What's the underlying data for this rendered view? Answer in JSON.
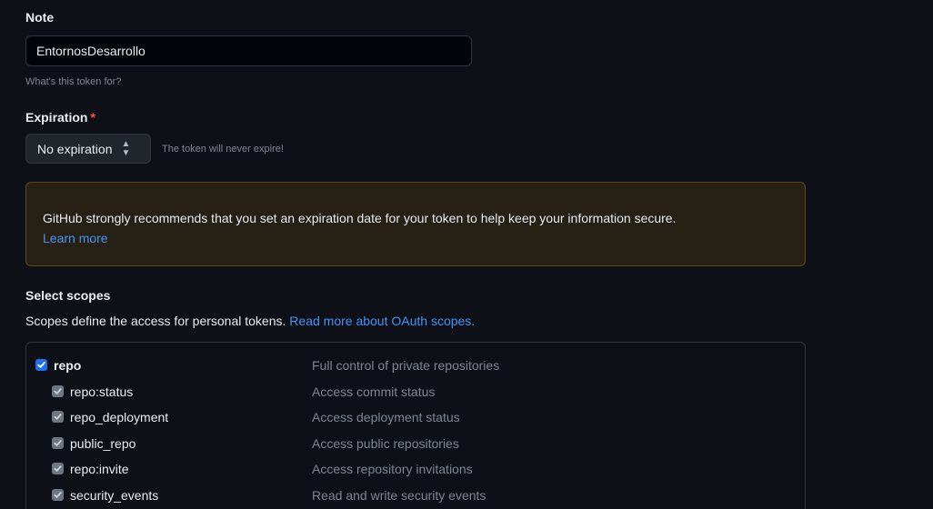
{
  "note": {
    "label": "Note",
    "value": "EntornosDesarrollo",
    "hint": "What's this token for?"
  },
  "expiration": {
    "label": "Expiration",
    "required_mark": "*",
    "selected": "No expiration",
    "hint": "The token will never expire!"
  },
  "warning": {
    "text": "GitHub strongly recommends that you set an expiration date for your token to help keep your information secure.",
    "link": "Learn more"
  },
  "scopes": {
    "title": "Select scopes",
    "description": "Scopes define the access for personal tokens.",
    "link": "Read more about OAuth scopes.",
    "items": [
      {
        "name": "repo",
        "description": "Full control of private repositories",
        "checked": true,
        "parent": true
      },
      {
        "name": "repo:status",
        "description": "Access commit status",
        "checked": true,
        "parent": false
      },
      {
        "name": "repo_deployment",
        "description": "Access deployment status",
        "checked": true,
        "parent": false
      },
      {
        "name": "public_repo",
        "description": "Access public repositories",
        "checked": true,
        "parent": false
      },
      {
        "name": "repo:invite",
        "description": "Access repository invitations",
        "checked": true,
        "parent": false
      },
      {
        "name": "security_events",
        "description": "Read and write security events",
        "checked": true,
        "parent": false
      }
    ]
  },
  "colors": {
    "background": "#0d1117",
    "accent_link": "#4493f8",
    "checkbox_primary": "#1f6feb",
    "checkbox_inherited": "#6e7681",
    "warning_bg": "#272115",
    "warning_border": "#5e4a18",
    "required": "#f85149"
  }
}
